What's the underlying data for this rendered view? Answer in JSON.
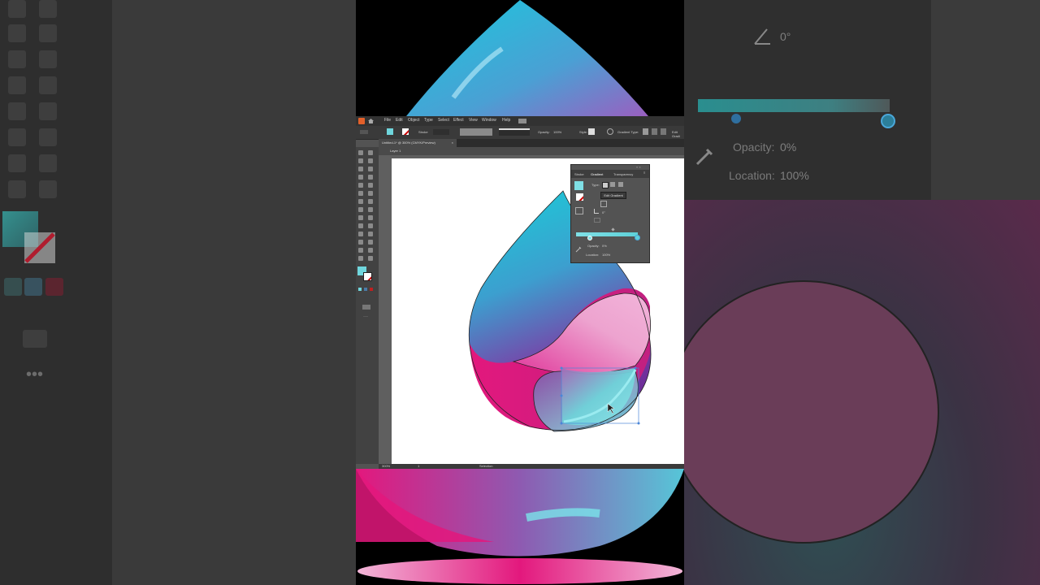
{
  "menu": {
    "items": [
      "File",
      "Edit",
      "Object",
      "Type",
      "Select",
      "Effect",
      "View",
      "Window",
      "Help"
    ]
  },
  "control_bar": {
    "stroke_label": "Stroke",
    "opacity_label": "Opacity:",
    "opacity_value": "100%",
    "style_label": "Style:",
    "gradient_type_label": "Gradient Type:",
    "edit_gradient": "Edit Gradi"
  },
  "document": {
    "tab_title": "Untitled-1* @ 300% (CMYK/Preview)",
    "layer_name": "Layer 1"
  },
  "status": {
    "zoom": "300%",
    "page": "1",
    "tool": "Selection"
  },
  "gradient_panel": {
    "tabs": [
      "Stroke",
      "Gradient",
      "Transparency"
    ],
    "type_label": "Type:",
    "edit_gradient": "Edit Gradient",
    "angle_value": "0°",
    "opacity_label": "Opacity:",
    "opacity_value": "0%",
    "location_label": "Location:",
    "location_value": "100%"
  },
  "zoomed_panel": {
    "angle_value": "0°",
    "opacity_label": "Opacity:",
    "opacity_value": "0%",
    "location_label": "Location:",
    "location_value": "100%"
  },
  "colors": {
    "cyan": "#27c3d3",
    "magenta": "#e3187d",
    "purple": "#7a2f9e",
    "pink_light": "#eda3cf"
  }
}
